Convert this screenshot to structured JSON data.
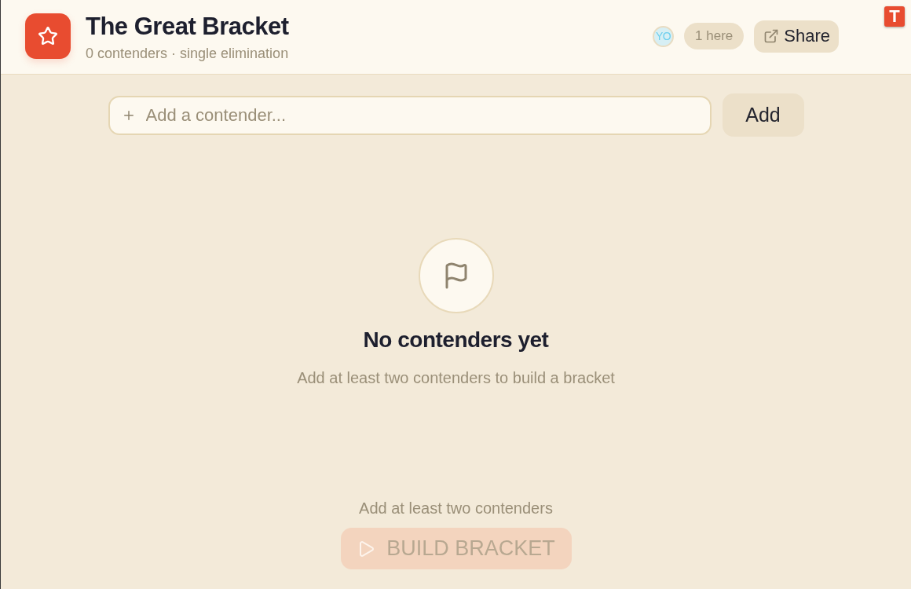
{
  "header": {
    "title": "The Great Bracket",
    "subtitle": "0 contenders · single elimination",
    "presence": {
      "avatar": "YO",
      "count": "1 here"
    },
    "share_button": "Share"
  },
  "corner_badge": "T",
  "add_form": {
    "placeholder": "Add a contender...",
    "button": "Add"
  },
  "empty_state": {
    "heading": "No contenders yet",
    "message": "Add at least two contenders to build a bracket"
  },
  "footer": {
    "hint": "Add at least two contenders",
    "build_button": {
      "label": "BUILD BRACKET",
      "disabled": true
    }
  }
}
